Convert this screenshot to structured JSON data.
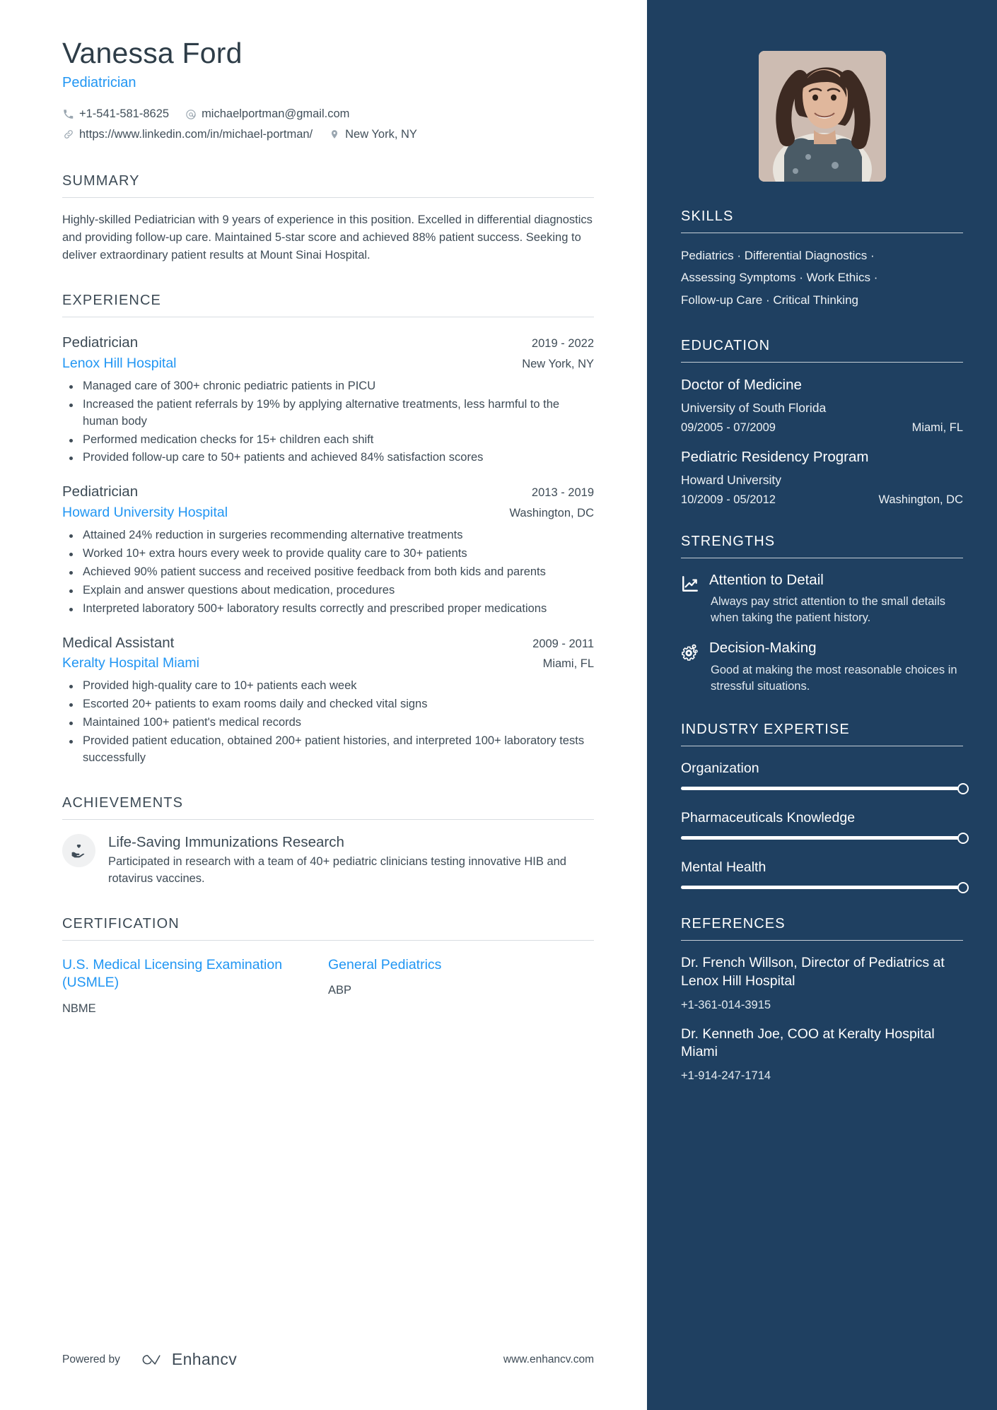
{
  "header": {
    "name": "Vanessa Ford",
    "role": "Pediatrician",
    "contacts": [
      {
        "icon": "phone-icon",
        "text": "+1-541-581-8625"
      },
      {
        "icon": "email-icon",
        "text": "michaelportman@gmail.com"
      },
      {
        "icon": "link-icon",
        "text": "https://www.linkedin.com/in/michael-portman/"
      },
      {
        "icon": "location-pin-icon",
        "text": "New York, NY"
      }
    ]
  },
  "summary": {
    "title": "SUMMARY",
    "text": "Highly-skilled Pediatrician with 9 years of experience in this position. Excelled in differential diagnostics and providing follow-up care. Maintained 5-star score and achieved 88% patient success. Seeking to deliver extraordinary patient results at Mount Sinai Hospital."
  },
  "experience": {
    "title": "EXPERIENCE",
    "jobs": [
      {
        "title": "Pediatrician",
        "dates": "2019 - 2022",
        "company": "Lenox Hill Hospital",
        "location": "New York, NY",
        "bullets": [
          "Managed care of 300+ chronic pediatric patients in PICU",
          "Increased the patient referrals by 19% by applying alternative treatments, less harmful to the human body",
          "Performed medication checks for 15+ children each shift",
          "Provided follow-up care to 50+ patients and achieved 84% satisfaction scores"
        ]
      },
      {
        "title": "Pediatrician",
        "dates": "2013 - 2019",
        "company": "Howard University Hospital",
        "location": "Washington, DC",
        "bullets": [
          "Attained 24% reduction in surgeries recommending alternative treatments",
          "Worked 10+ extra hours every week to provide quality care to 30+ patients",
          "Achieved 90% patient success and received positive feedback from both kids and parents",
          "Explain and answer questions about medication, procedures",
          "Interpreted laboratory 500+ laboratory results correctly and prescribed proper medications"
        ]
      },
      {
        "title": "Medical Assistant",
        "dates": "2009 - 2011",
        "company": "Keralty Hospital Miami",
        "location": "Miami, FL",
        "bullets": [
          "Provided high-quality care to 10+ patients each week",
          "Escorted 20+ patients to exam rooms daily and checked vital signs",
          "Maintained 100+ patient's medical records",
          "Provided patient education, obtained 200+ patient histories, and interpreted 100+ laboratory tests successfully"
        ]
      }
    ]
  },
  "achievements": {
    "title": "ACHIEVEMENTS",
    "items": [
      {
        "icon": "hand-heart-icon",
        "title": "Life-Saving Immunizations Research",
        "desc": "Participated in research with a team of 40+ pediatric clinicians testing innovative HIB and rotavirus vaccines."
      }
    ]
  },
  "certification": {
    "title": "CERTIFICATION",
    "items": [
      {
        "name": "U.S. Medical Licensing Examination (USMLE)",
        "issuer": "NBME"
      },
      {
        "name": "General Pediatrics",
        "issuer": "ABP"
      }
    ]
  },
  "footer": {
    "powered_by": "Powered by",
    "brand": "Enhancv",
    "url": "www.enhancv.com"
  },
  "sidebar": {
    "skills": {
      "title": "SKILLS",
      "lines": [
        "Pediatrics · Differential Diagnostics ·",
        "Assessing Symptoms · Work Ethics ·",
        "Follow-up Care · Critical Thinking"
      ]
    },
    "education": {
      "title": "EDUCATION",
      "items": [
        {
          "degree": "Doctor of Medicine",
          "school": "University of South Florida",
          "dates": "09/2005 - 07/2009",
          "location": "Miami, FL"
        },
        {
          "degree": "Pediatric Residency Program",
          "school": "Howard University",
          "dates": "10/2009 - 05/2012",
          "location": "Washington, DC"
        }
      ]
    },
    "strengths": {
      "title": "STRENGTHS",
      "items": [
        {
          "icon": "growth-chart-icon",
          "title": "Attention to Detail",
          "desc": "Always pay strict attention to the small details when taking the patient history."
        },
        {
          "icon": "gears-icon",
          "title": "Decision-Making",
          "desc": "Good at making the most reasonable choices in stressful situations."
        }
      ]
    },
    "expertise": {
      "title": "INDUSTRY EXPERTISE",
      "items": [
        {
          "label": "Organization",
          "value": 100
        },
        {
          "label": "Pharmaceuticals Knowledge",
          "value": 100
        },
        {
          "label": "Mental Health",
          "value": 100
        }
      ]
    },
    "references": {
      "title": "REFERENCES",
      "items": [
        {
          "name": "Dr. French Willson, Director of Pediatrics at Lenox Hill Hospital",
          "phone": "+1-361-014-3915"
        },
        {
          "name": "Dr. Kenneth Joe, COO at Keralty Hospital Miami",
          "phone": "+1-914-247-1714"
        }
      ]
    }
  },
  "colors": {
    "accent_blue": "#2196f3",
    "sidebar_bg": "#1f4061",
    "text_dark": "#3f4c57"
  }
}
